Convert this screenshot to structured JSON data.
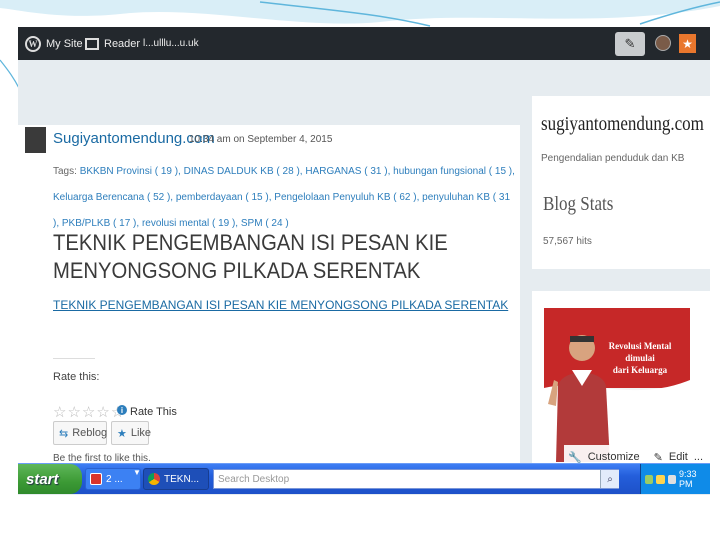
{
  "colors": {
    "admin_bar": "#23282d",
    "link_blue": "#1a6aa3",
    "notification": "#e9772d",
    "taskbar_blue": "#245edb",
    "start_green": "#3c9a35"
  },
  "admin_bar": {
    "my_site": "My Site",
    "reader": "Reader",
    "extra": "l...ulllu...u.uk"
  },
  "post": {
    "site_name": "Sugiyantomendung.com",
    "date": "10:34 am on September 4, 2015",
    "tags_label": "Tags:",
    "tags": [
      "BKKBN Provinsi ( 19 ),",
      "DINAS DALDUK KB ( 28 ),",
      "HARGANAS ( 31 ),",
      "hubungan fungsional ( 15 ),",
      "Keluarga Berencana (",
      "52 ),",
      "pemberdayaan ( 15 ),",
      "Pengelolaan Penyuluh KB ( 62 ),",
      "penyuluhan KB ( 31 ),",
      "PKB/PLKB ( 17 ),",
      "revolusi mental ( 19 ),",
      "SPM ( 24 )"
    ],
    "title": "TEKNIK PENGEMBANGAN ISI PESAN KIE MENYONGSONG PILKADA SERENTAK",
    "link_text": "TEKNIK PENGEMBANGAN ISI PESAN KIE MENYONGSONG PILKADA SERENTAK",
    "rate_label": "Rate this:",
    "rate_this": "Rate This",
    "rating_stars": 0,
    "reblog": "Reblog",
    "like": "Like",
    "first_like": "Be the first to like this."
  },
  "sidebar": {
    "site_name": "sugiyantomendung.com",
    "tagline": "Pengendalian penduduk dan KB",
    "stats_title": "Blog Stats",
    "hits": "57,567 hits",
    "banner_line1": "Revolusi Mental dimulai",
    "banner_line2": "dari Keluarga",
    "customize": "Customize",
    "edit": "Edit",
    "more": "..."
  },
  "taskbar": {
    "start": "start",
    "task1": "2 ...",
    "task2": "TEKN...",
    "search_placeholder": "Search Desktop",
    "clock": "9:33 PM"
  },
  "icons": {
    "wp": "wordpress-icon",
    "reader": "reader-icon",
    "write": "write-icon",
    "notifications": "star-icon"
  }
}
